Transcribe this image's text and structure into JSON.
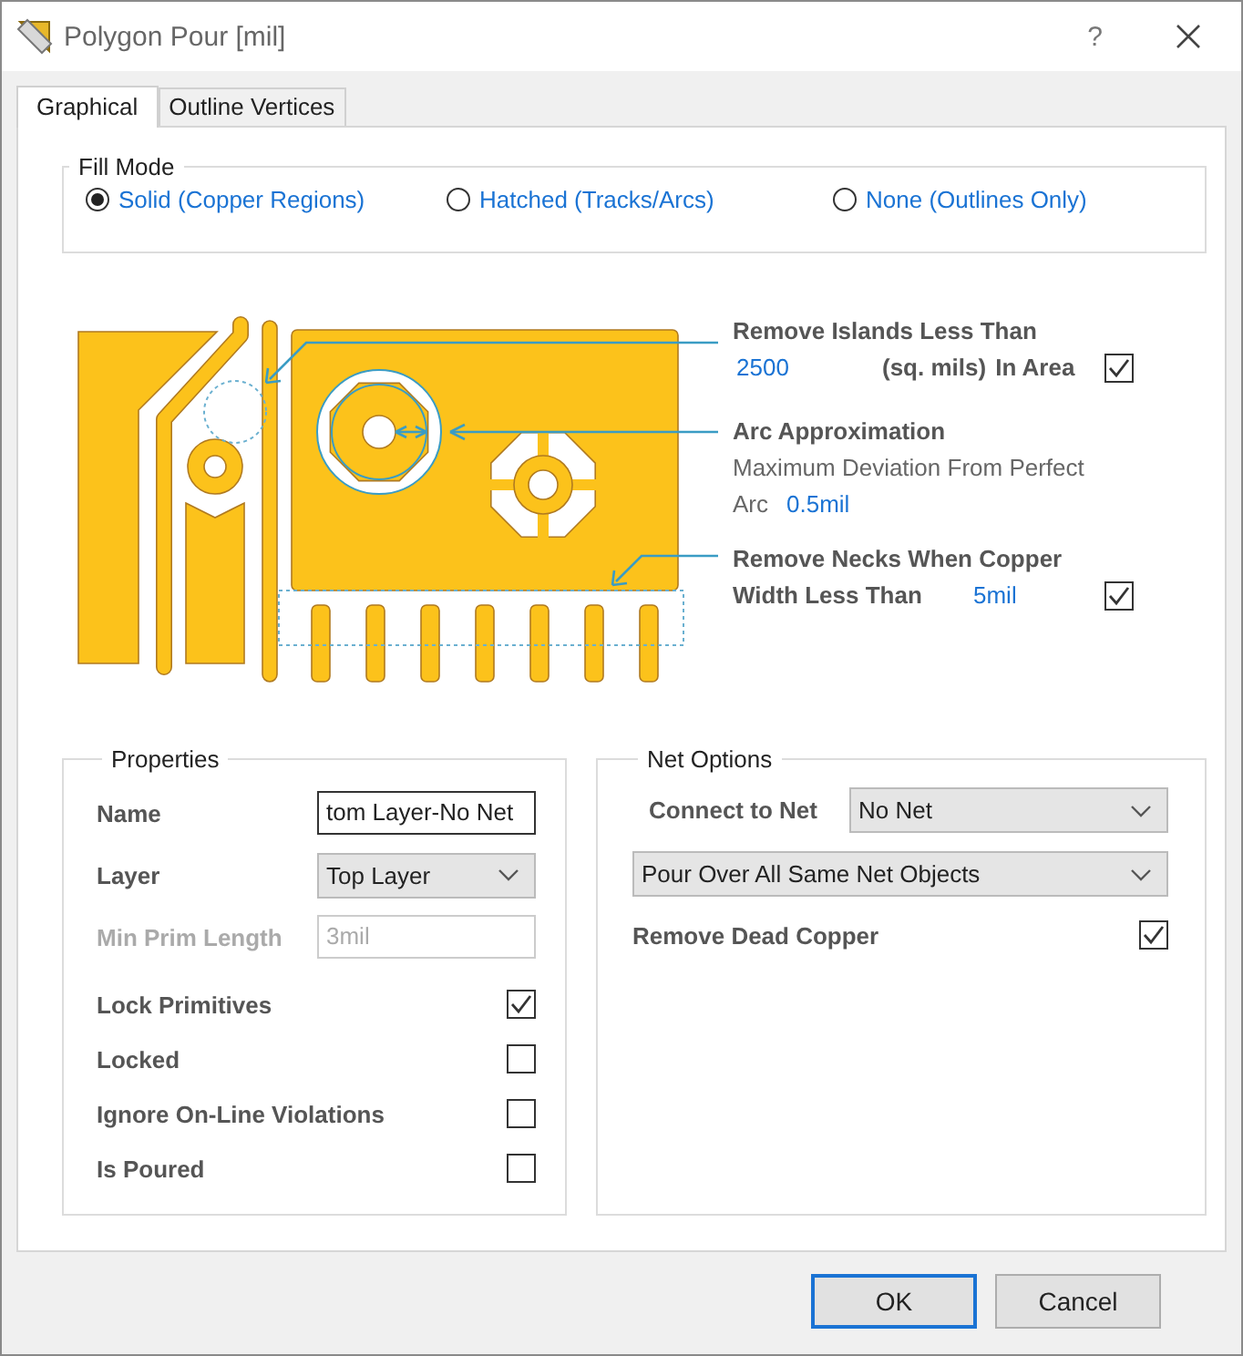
{
  "window": {
    "title": "Polygon Pour [mil]",
    "help": "?"
  },
  "tabs": [
    {
      "label": "Graphical",
      "selected": true
    },
    {
      "label": "Outline Vertices",
      "selected": false
    }
  ],
  "fill_mode": {
    "title": "Fill Mode",
    "options": [
      {
        "label": "Solid (Copper Regions)",
        "selected": true
      },
      {
        "label": "Hatched (Tracks/Arcs)",
        "selected": false
      },
      {
        "label": "None (Outlines Only)",
        "selected": false
      }
    ]
  },
  "diagram": {
    "remove_islands": {
      "label": "Remove Islands Less Than",
      "value": "2500",
      "unit": "(sq. mils)",
      "suffix": "In Area",
      "checked": true
    },
    "arc": {
      "label": "Arc Approximation",
      "description": "Maximum Deviation From Perfect",
      "sub_label": "Arc",
      "value": "0.5mil"
    },
    "necks": {
      "label": "Remove Necks When Copper",
      "label2": "Width Less Than",
      "value": "5mil",
      "checked": true
    }
  },
  "properties": {
    "title": "Properties",
    "fields": [
      {
        "kind": "text",
        "label": "Name",
        "value": "tom Layer-No Net",
        "disabled": false
      },
      {
        "kind": "select",
        "label": "Layer",
        "value": "Top Layer",
        "disabled": false
      },
      {
        "kind": "text",
        "label": "Min Prim Length",
        "value": "3mil",
        "disabled": true
      }
    ],
    "checkboxes": [
      {
        "label": "Lock Primitives",
        "checked": true
      },
      {
        "label": "Locked",
        "checked": false
      },
      {
        "label": "Ignore On-Line Violations",
        "checked": false
      },
      {
        "label": "Is Poured",
        "checked": false
      }
    ]
  },
  "net_options": {
    "title": "Net Options",
    "connect": {
      "label": "Connect to Net",
      "value": "No Net"
    },
    "pour_over": {
      "value": "Pour Over All Same Net Objects"
    },
    "remove_dead": {
      "label": "Remove Dead Copper",
      "checked": true
    }
  },
  "buttons": [
    {
      "label": "OK",
      "default": true
    },
    {
      "label": "Cancel",
      "default": false
    }
  ]
}
